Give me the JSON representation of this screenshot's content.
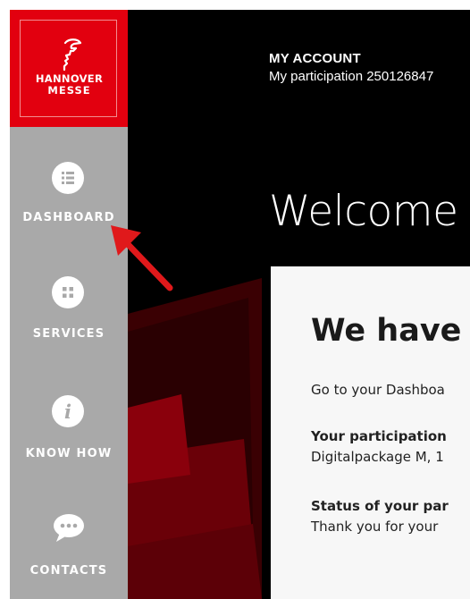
{
  "sidebar": {
    "logo": {
      "line1": "HANNOVER",
      "line2": "MESSE"
    },
    "items": [
      {
        "label": "DASHBOARD",
        "icon": "list-icon"
      },
      {
        "label": "SERVICES",
        "icon": "grid-icon"
      },
      {
        "label": "KNOW HOW",
        "icon": "info-icon"
      },
      {
        "label": "CONTACTS",
        "icon": "chat-bubble-icon"
      }
    ]
  },
  "header": {
    "account_title": "MY ACCOUNT",
    "participation": "My participation 250126847"
  },
  "main": {
    "welcome": "Welcome",
    "card": {
      "heading": "We have",
      "intro": "Go to your Dashboa",
      "participation_label": "Your participation",
      "participation_value": "Digitalpackage M, 1",
      "status_label": "Status of your par",
      "status_value": "Thank you for your"
    }
  },
  "colors": {
    "brand_red": "#e2000f",
    "sidebar_gray": "#a9a9a9",
    "annotation_arrow": "#e0191b"
  }
}
